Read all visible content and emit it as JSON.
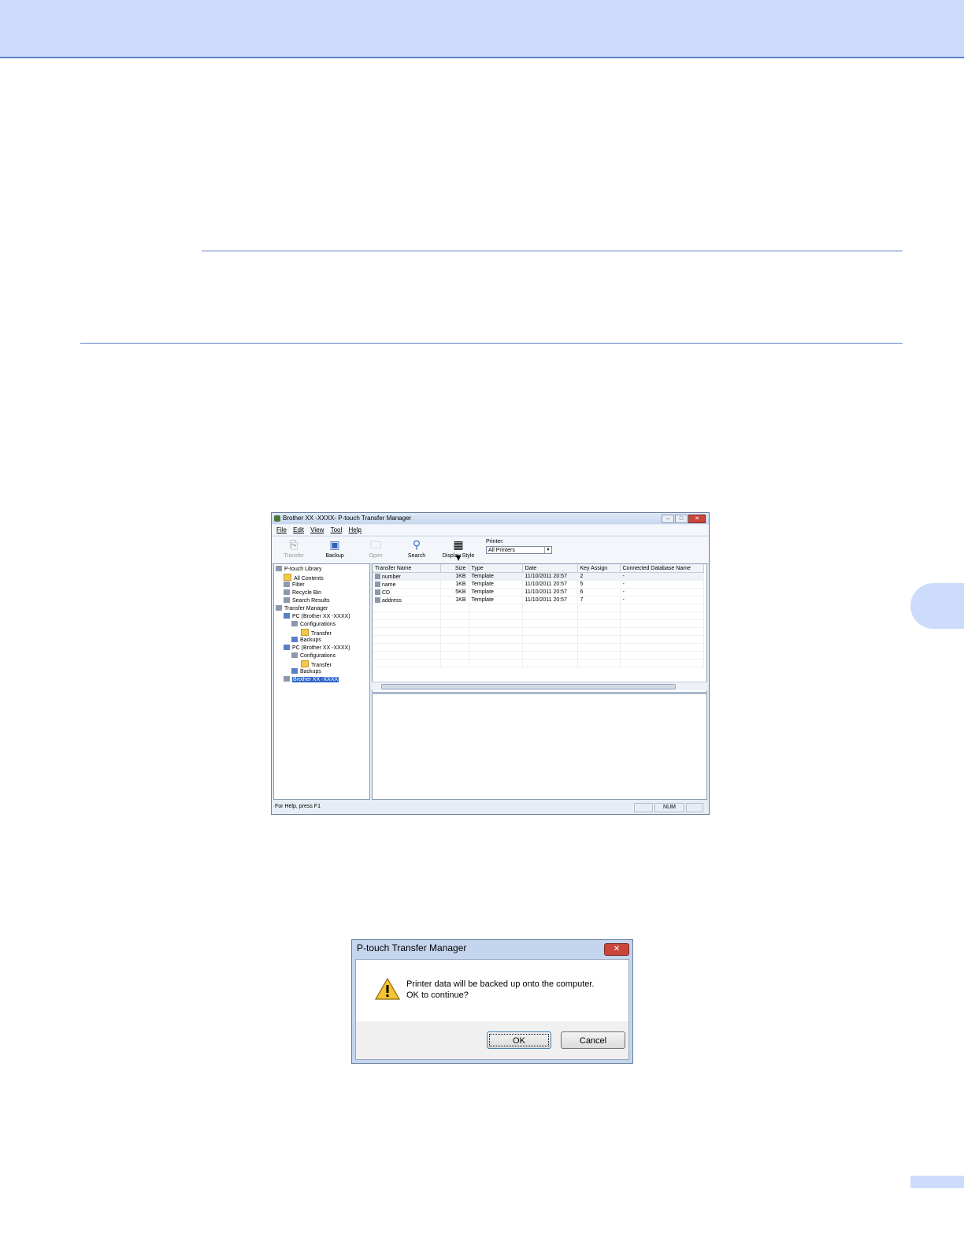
{
  "window": {
    "title": "Brother XX -XXXX- P-touch Transfer Manager",
    "menu": [
      "File",
      "Edit",
      "View",
      "Tool",
      "Help"
    ],
    "toolbar": {
      "transfer": "Transfer",
      "backup": "Backup",
      "open": "Open",
      "search": "Search",
      "display_style": "Display Style",
      "printer_label": "Printer:",
      "printer_value": "All Printers"
    },
    "tree": {
      "library": "P-touch Library",
      "all_contents": "All Contents",
      "filter": "Filter",
      "recycle_bin": "Recycle Bin",
      "search_results": "Search Results",
      "transfer_manager": "Transfer Manager",
      "pc1": "PC (Brother XX -XXXX)",
      "pc1_config": "Configurations",
      "pc1_transfer": "Transfer",
      "pc1_backups": "Backups",
      "pc2": "PC (Brother XX -XXXX)",
      "pc2_config": "Configurations",
      "pc2_transfer": "Transfer",
      "pc2_backups": "Backups",
      "printer": "Brother XX -XXXX"
    },
    "table": {
      "columns": [
        "Transfer Name",
        "Size",
        "Type",
        "Date",
        "Key Assign",
        "Connected Database Name"
      ],
      "rows": [
        [
          "number",
          "1KB",
          "Template",
          "11/10/2011 20:57",
          "2",
          "-"
        ],
        [
          "name",
          "1KB",
          "Template",
          "11/10/2011 20:57",
          "5",
          "-"
        ],
        [
          "CD",
          "5KB",
          "Template",
          "11/10/2011 20:57",
          "6",
          "-"
        ],
        [
          "address",
          "1KB",
          "Template",
          "11/10/2011 20:57",
          "7",
          "-"
        ]
      ]
    },
    "status": {
      "help": "For Help, press F1",
      "num": "NUM"
    }
  },
  "dialog": {
    "title": "P-touch Transfer Manager",
    "line1": "Printer data will be backed up onto the computer.",
    "line2": "OK to continue?",
    "ok": "OK",
    "cancel": "Cancel"
  }
}
